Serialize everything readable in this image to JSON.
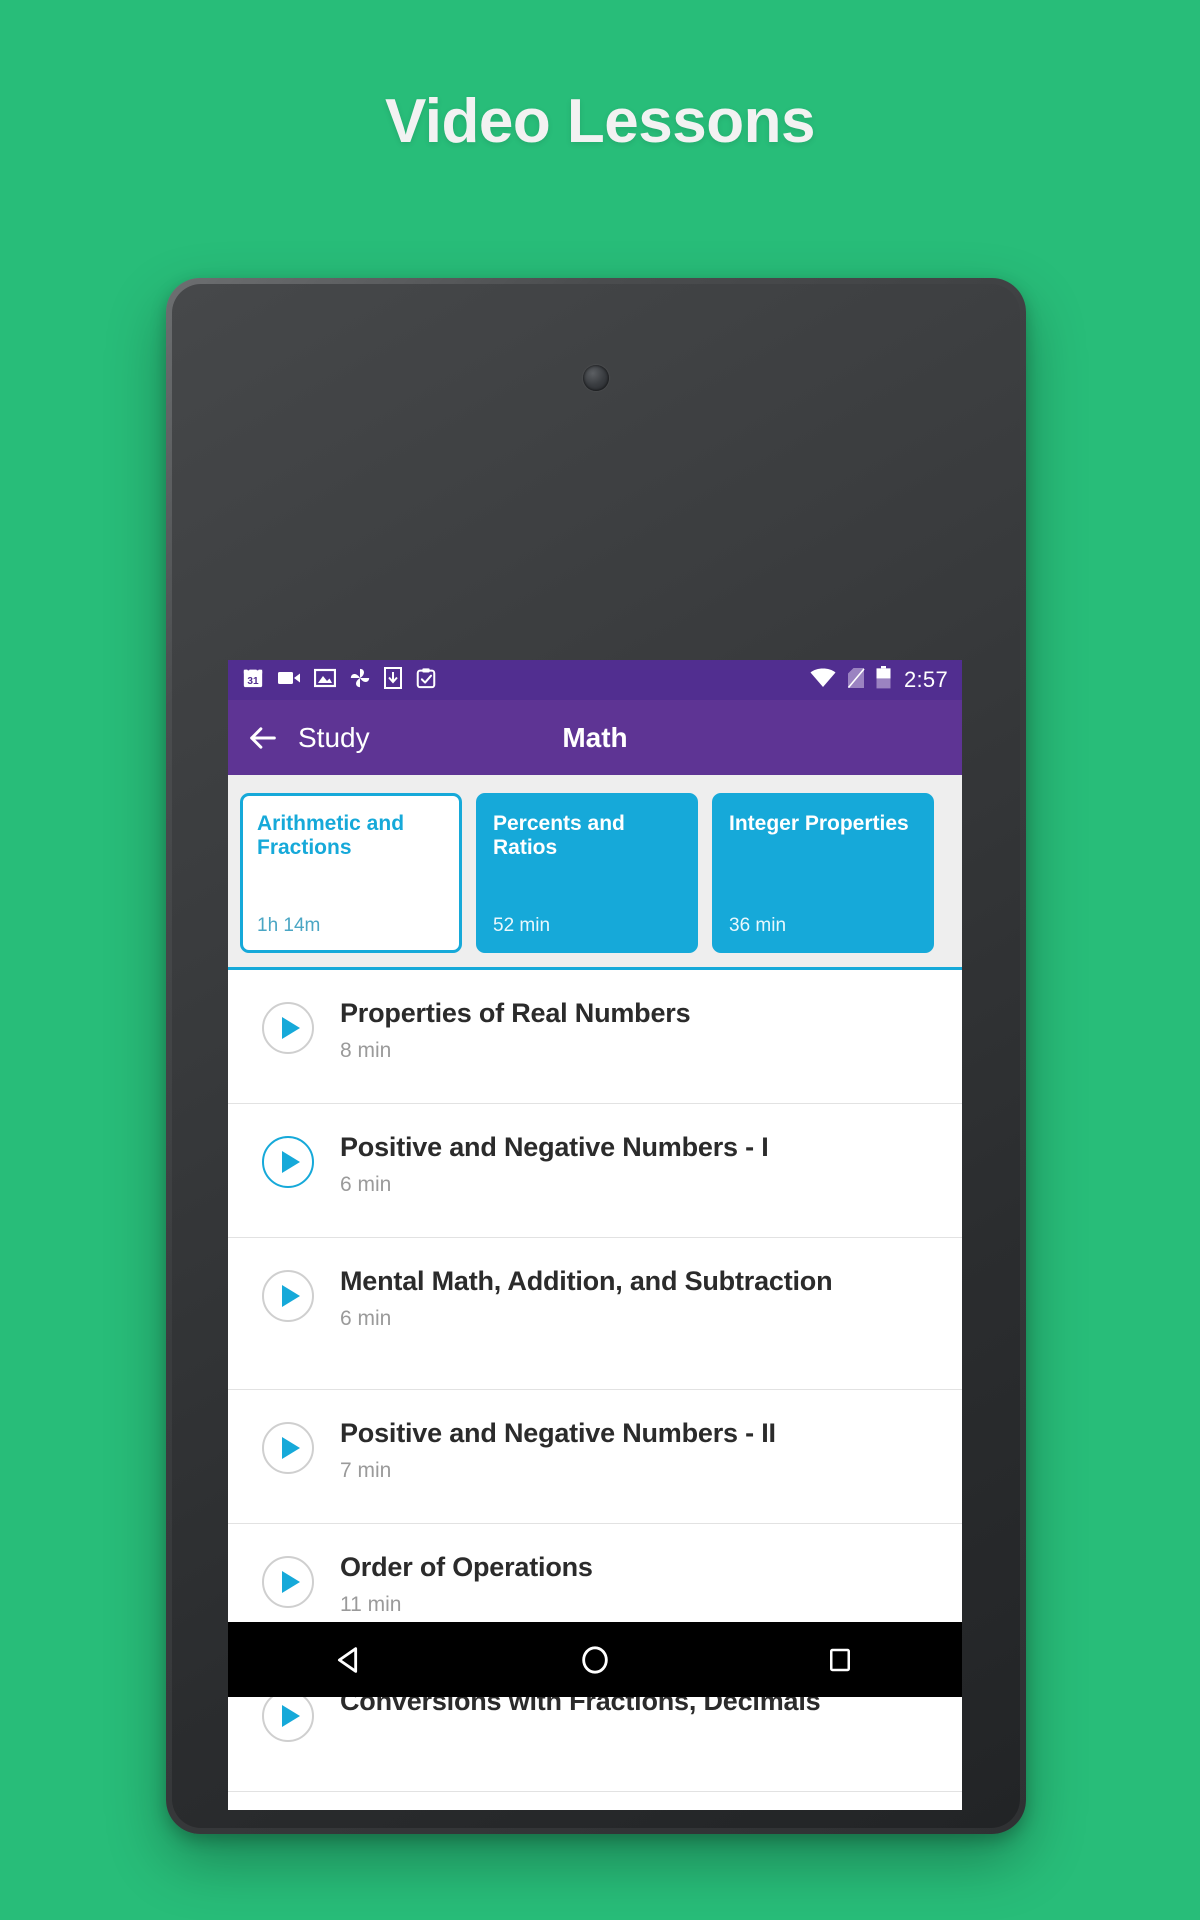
{
  "promo": {
    "title": "Video Lessons",
    "background_color": "#28bd79",
    "title_color": "#f2f2f2"
  },
  "device": {
    "type": "android-tablet",
    "frame_color": "#3a3c3e"
  },
  "status_bar": {
    "background_color": "#512e90",
    "time": "2:57",
    "left_icons": [
      "calendar-icon",
      "video-camera-icon",
      "photo-icon",
      "pinwheel-icon",
      "download-icon",
      "clipboard-check-icon"
    ],
    "right_icons": [
      "wifi-icon",
      "no-sim-icon",
      "battery-icon"
    ]
  },
  "app_bar": {
    "background_color": "#5e3494",
    "back_icon": "arrow-back-icon",
    "up_label": "Study",
    "title": "Math"
  },
  "categories": {
    "accent_color": "#16a9d9",
    "items": [
      {
        "name": "Arithmetic and Fractions",
        "duration": "1h 14m",
        "selected": true
      },
      {
        "name": "Percents and Ratios",
        "duration": "52 min",
        "selected": false
      },
      {
        "name": "Integer Properties",
        "duration": "36 min",
        "selected": false
      }
    ]
  },
  "lessons": {
    "items": [
      {
        "title": "Properties of Real Numbers",
        "duration": "8 min",
        "play_icon": "play-icon",
        "active": false
      },
      {
        "title": "Positive and Negative Numbers - I",
        "duration": "6 min",
        "play_icon": "play-icon",
        "active": true
      },
      {
        "title": "Mental Math, Addition, and Subtraction",
        "duration": "6 min",
        "play_icon": "play-icon",
        "active": false
      },
      {
        "title": "Positive and Negative Numbers - II",
        "duration": "7 min",
        "play_icon": "play-icon",
        "active": false
      },
      {
        "title": "Order of Operations",
        "duration": "11 min",
        "play_icon": "play-icon",
        "active": false
      },
      {
        "title": "Conversions with Fractions, Decimals",
        "duration": "",
        "play_icon": "play-icon",
        "active": false
      }
    ]
  },
  "nav_bar": {
    "background_color": "#000000",
    "buttons": [
      {
        "icon": "back-triangle-icon",
        "label": "Back"
      },
      {
        "icon": "home-circle-icon",
        "label": "Home"
      },
      {
        "icon": "recents-square-icon",
        "label": "Recents"
      }
    ]
  }
}
